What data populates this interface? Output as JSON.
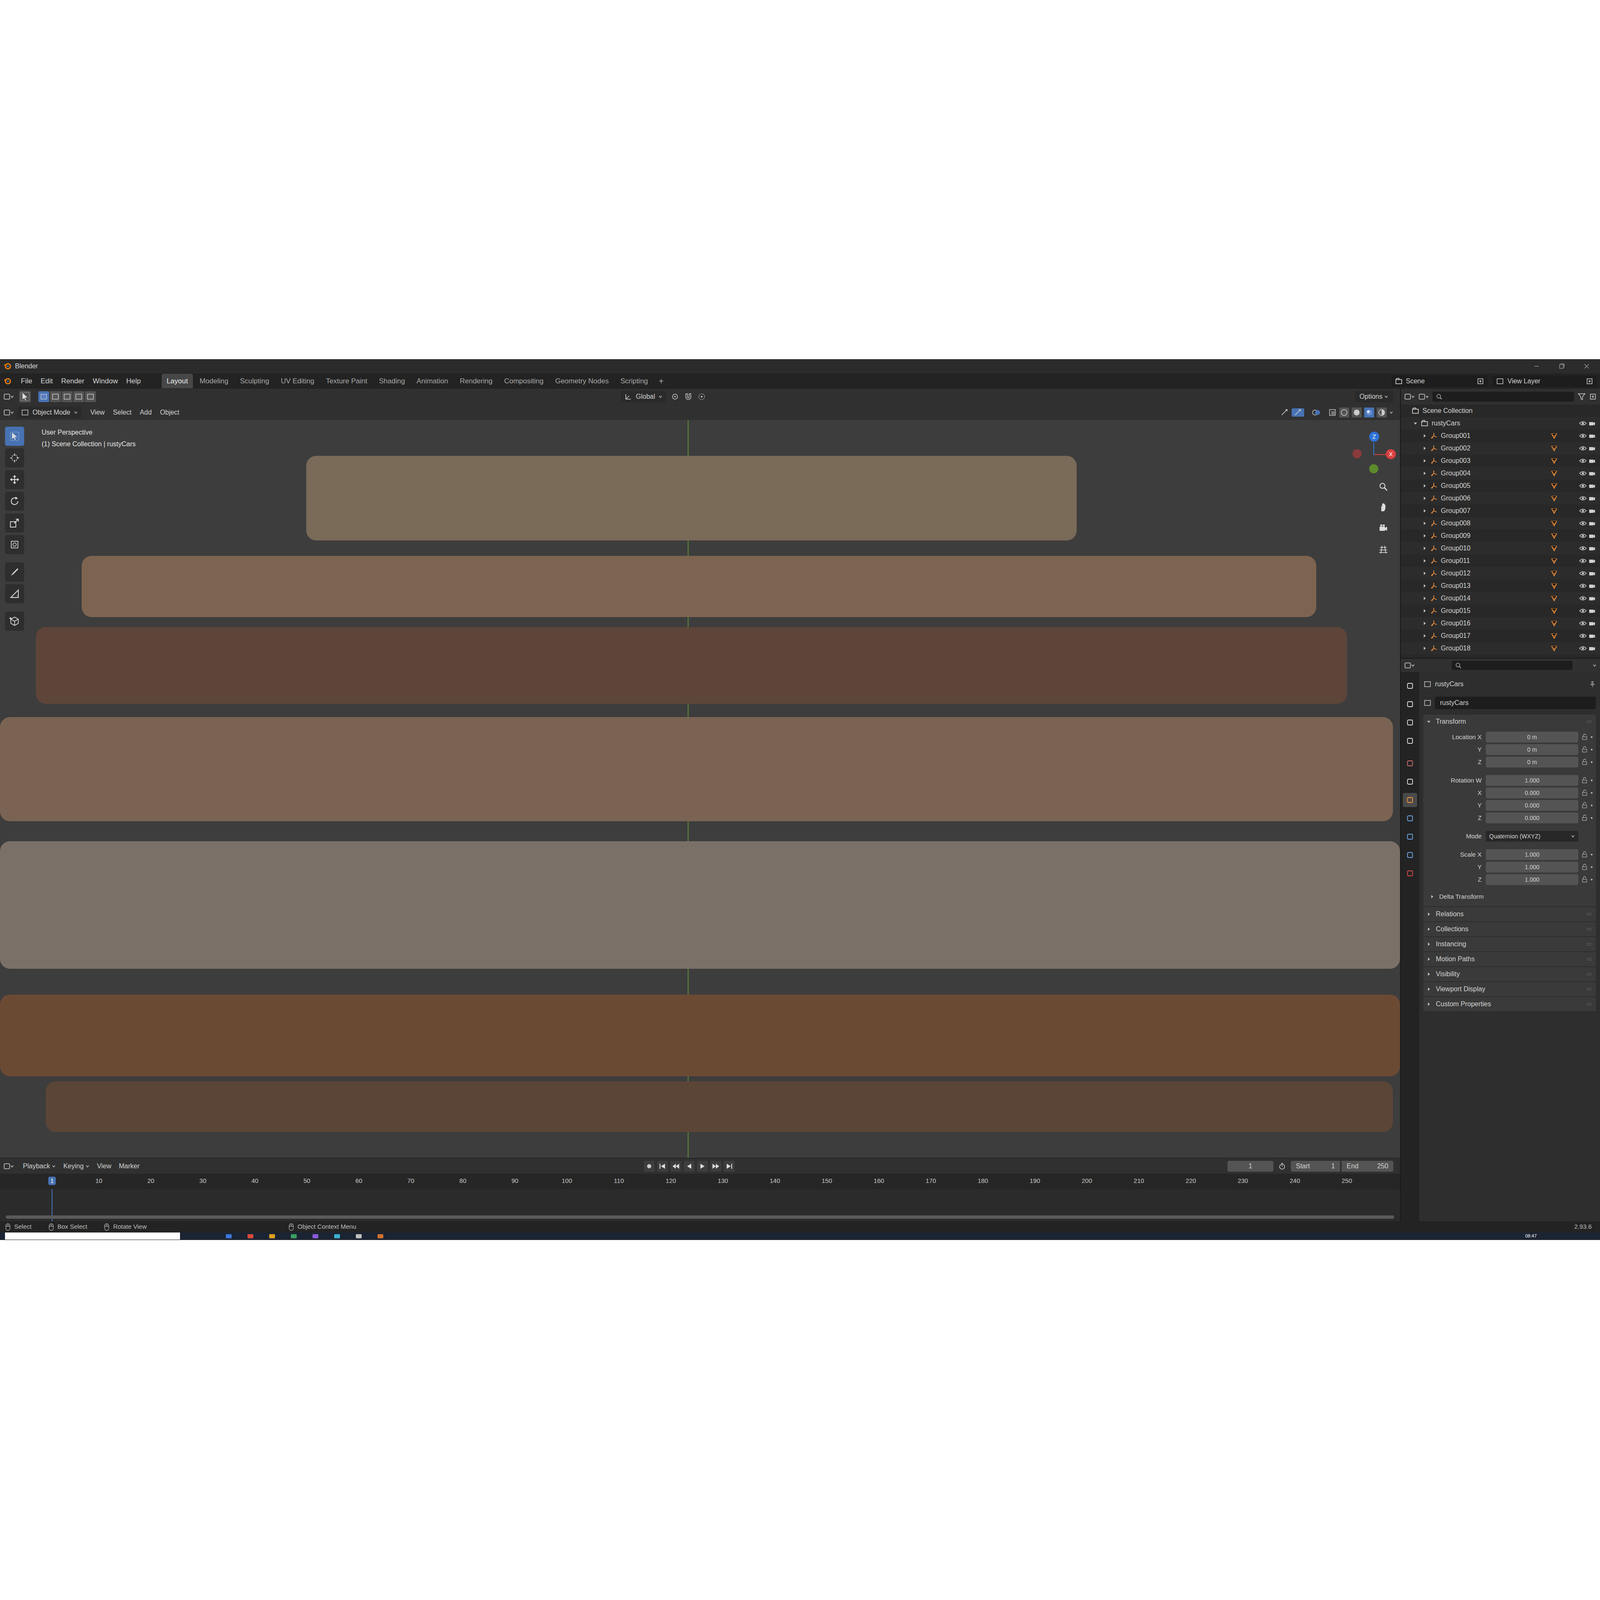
{
  "window": {
    "title": "Blender"
  },
  "menu": [
    "File",
    "Edit",
    "Render",
    "Window",
    "Help"
  ],
  "workspaces": [
    {
      "label": "Layout",
      "selected": true
    },
    {
      "label": "Modeling",
      "selected": false
    },
    {
      "label": "Sculpting",
      "selected": false
    },
    {
      "label": "UV Editing",
      "selected": false
    },
    {
      "label": "Texture Paint",
      "selected": false
    },
    {
      "label": "Shading",
      "selected": false
    },
    {
      "label": "Animation",
      "selected": false
    },
    {
      "label": "Rendering",
      "selected": false
    },
    {
      "label": "Compositing",
      "selected": false
    },
    {
      "label": "Geometry Nodes",
      "selected": false
    },
    {
      "label": "Scripting",
      "selected": false
    }
  ],
  "workspace_add": "+",
  "scene": "Scene",
  "view_layer": "View Layer",
  "tool_header": {
    "orientation": "Global",
    "options": "Options"
  },
  "viewport_header": {
    "mode": "Object Mode",
    "menus": [
      "View",
      "Select",
      "Add",
      "Object"
    ]
  },
  "viewport": {
    "overlay": [
      "User Perspective",
      "(1) Scene Collection | rustyCars"
    ],
    "gizmo": [
      "Z",
      "X"
    ]
  },
  "tools": [
    {
      "selected": true
    },
    {
      "selected": false
    },
    {
      "selected": false
    },
    {
      "selected": false
    },
    {
      "selected": false
    },
    {
      "selected": false
    },
    {
      "selected": false
    },
    {
      "selected": false
    },
    {
      "selected": false
    }
  ],
  "outliner": {
    "root": "Scene Collection",
    "collection": {
      "label": "rustyCars",
      "expanded": true
    },
    "items": [
      {
        "label": "Group001",
        "expanded": false,
        "visible": true
      },
      {
        "label": "Group002",
        "expanded": false,
        "visible": true
      },
      {
        "label": "Group003",
        "expanded": false,
        "visible": true
      },
      {
        "label": "Group004",
        "expanded": false,
        "visible": true
      },
      {
        "label": "Group005",
        "expanded": false,
        "visible": true
      },
      {
        "label": "Group006",
        "expanded": false,
        "visible": true
      },
      {
        "label": "Group007",
        "expanded": false,
        "visible": true
      },
      {
        "label": "Group008",
        "expanded": false,
        "visible": true
      },
      {
        "label": "Group009",
        "expanded": false,
        "visible": true
      },
      {
        "label": "Group010",
        "expanded": false,
        "visible": true
      },
      {
        "label": "Group011",
        "expanded": false,
        "visible": true
      },
      {
        "label": "Group012",
        "expanded": false,
        "visible": true
      },
      {
        "label": "Group013",
        "expanded": false,
        "visible": true
      },
      {
        "label": "Group014",
        "expanded": false,
        "visible": true
      },
      {
        "label": "Group015",
        "expanded": false,
        "visible": true
      },
      {
        "label": "Group016",
        "expanded": false,
        "visible": true
      },
      {
        "label": "Group017",
        "expanded": false,
        "visible": true
      },
      {
        "label": "Group018",
        "expanded": false,
        "visible": true
      }
    ]
  },
  "property_tabs": [
    {
      "selected": false
    },
    {
      "selected": false
    },
    {
      "selected": false
    },
    {
      "selected": false
    },
    {
      "selected": false
    },
    {
      "selected": false
    },
    {
      "selected": true
    },
    {
      "selected": false
    },
    {
      "selected": false
    },
    {
      "selected": false
    },
    {
      "selected": false
    }
  ],
  "properties": {
    "context": "rustyCars",
    "object_name": "rustyCars",
    "panel": {
      "label": "Transform",
      "expanded": true
    },
    "rows": [
      {
        "label": "Location X",
        "value": "0 m",
        "kind": "number"
      },
      {
        "label": "Y",
        "value": "0 m",
        "kind": "number"
      },
      {
        "label": "Z",
        "value": "0 m",
        "kind": "number"
      },
      {
        "label": "Rotation W",
        "value": "1.000",
        "kind": "number"
      },
      {
        "label": "X",
        "value": "0.000",
        "kind": "number"
      },
      {
        "label": "Y",
        "value": "0.000",
        "kind": "number"
      },
      {
        "label": "Z",
        "value": "0.000",
        "kind": "number"
      },
      {
        "label": "Mode",
        "value": "Quaternion (WXYZ)",
        "kind": "dropdown"
      },
      {
        "label": "Scale X",
        "value": "1.000",
        "kind": "number"
      },
      {
        "label": "Y",
        "value": "1.000",
        "kind": "number"
      },
      {
        "label": "Z",
        "value": "1.000",
        "kind": "number"
      }
    ],
    "subpanel": {
      "label": "Delta Transform",
      "expanded": false
    },
    "sections": [
      {
        "label": "Relations",
        "expanded": false
      },
      {
        "label": "Collections",
        "expanded": false
      },
      {
        "label": "Instancing",
        "expanded": false
      },
      {
        "label": "Motion Paths",
        "expanded": false
      },
      {
        "label": "Visibility",
        "expanded": false
      },
      {
        "label": "Viewport Display",
        "expanded": false
      },
      {
        "label": "Custom Properties",
        "expanded": false
      }
    ]
  },
  "timeline": {
    "menus": [
      "Playback",
      "Keying",
      "View",
      "Marker"
    ],
    "current_frame": "1",
    "start_label": "Start",
    "start": "1",
    "end_label": "End",
    "end": "250",
    "ticks": [
      {
        "label": "1",
        "current": true
      },
      {
        "label": "10",
        "current": false
      },
      {
        "label": "20",
        "current": false
      },
      {
        "label": "30",
        "current": false
      },
      {
        "label": "40",
        "current": false
      },
      {
        "label": "50",
        "current": false
      },
      {
        "label": "60",
        "current": false
      },
      {
        "label": "70",
        "current": false
      },
      {
        "label": "80",
        "current": false
      },
      {
        "label": "90",
        "current": false
      },
      {
        "label": "100",
        "current": false
      },
      {
        "label": "110",
        "current": false
      },
      {
        "label": "120",
        "current": false
      },
      {
        "label": "130",
        "current": false
      },
      {
        "label": "140",
        "current": false
      },
      {
        "label": "150",
        "current": false
      },
      {
        "label": "160",
        "current": false
      },
      {
        "label": "170",
        "current": false
      },
      {
        "label": "180",
        "current": false
      },
      {
        "label": "190",
        "current": false
      },
      {
        "label": "200",
        "current": false
      },
      {
        "label": "210",
        "current": false
      },
      {
        "label": "220",
        "current": false
      },
      {
        "label": "230",
        "current": false
      },
      {
        "label": "240",
        "current": false
      },
      {
        "label": "250",
        "current": false
      }
    ]
  },
  "status_bar": {
    "items": [
      "Select",
      "Box Select",
      "Rotate View",
      "Object Context Menu"
    ],
    "version": "2.93.6"
  },
  "taskbar": {
    "clock": "08:47"
  }
}
